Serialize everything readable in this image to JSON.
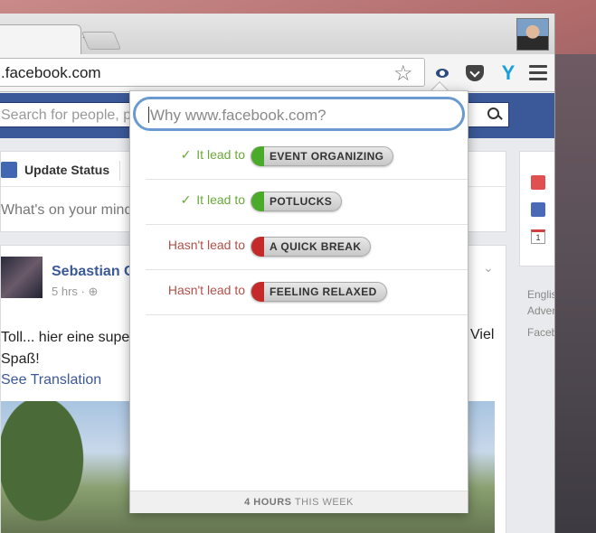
{
  "browser": {
    "tab_close": "×",
    "url": ".facebook.com"
  },
  "facebook": {
    "search_placeholder": "Search for people, p",
    "composer": {
      "tab_label": "Update Status",
      "prompt": "What's on your mind"
    },
    "post": {
      "author": "Sebastian C",
      "meta": "5 hrs · ⊕",
      "text_line1": "Toll... hier eine supe",
      "text_right": "Viel",
      "text_line2": "Spaß!",
      "translation_link": "See Translation"
    },
    "right_column": {
      "calendar_day": "1",
      "footer_lines": [
        "Englis",
        "Adver",
        "Faceb"
      ]
    }
  },
  "popup": {
    "input_placeholder": "Why www.facebook.com?",
    "rows": [
      {
        "status": "It lead to",
        "positive": true,
        "tag": "EVENT ORGANIZING"
      },
      {
        "status": "It lead to",
        "positive": true,
        "tag": "POTLUCKS"
      },
      {
        "status": "Hasn't lead to",
        "positive": false,
        "tag": "A QUICK BREAK"
      },
      {
        "status": "Hasn't lead to",
        "positive": false,
        "tag": "FEELING RELAXED"
      }
    ],
    "footer": {
      "hours": "4 HOURS",
      "suffix": "THIS WEEK"
    }
  },
  "colors": {
    "positive": "#6aaa3a",
    "negative": "#b0504a",
    "facebook_blue": "#3b5998"
  }
}
